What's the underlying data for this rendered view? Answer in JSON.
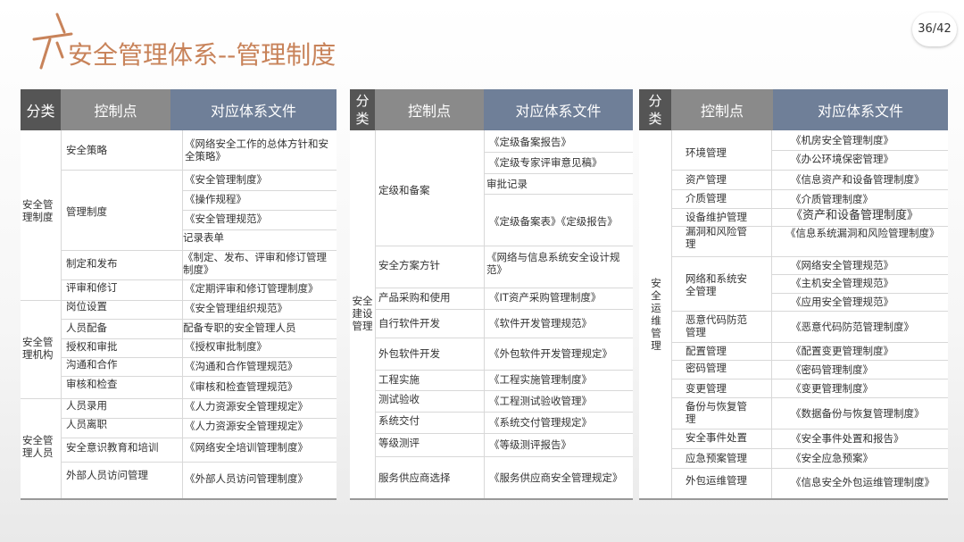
{
  "title": "安全管理体系--管理制度",
  "page": "36/42",
  "panel1": {
    "headers": [
      "分类",
      "控制点",
      "对应体系文件"
    ],
    "categories": [
      "安全管理制度",
      "安全管理机构",
      "安全管理人员"
    ],
    "controls": [
      "安全策略",
      "管理制度",
      "制定和发布",
      "评审和修订",
      "岗位设置",
      "人员配备",
      "授权和审批",
      "沟通和合作",
      "审核和检查",
      "人员录用",
      "人员离职",
      "安全意识教育和培训",
      "外部人员访问管理"
    ],
    "docs": [
      "《网络安全工作的总体方针和安全策略》",
      "《安全管理制度》",
      "《操作规程》",
      "《安全管理规范》",
      "记录表单",
      "《制定、发布、评审和修订管理制度》",
      "《定期评审和修订管理制度》",
      "《安全管理组织规范》",
      "配备专职的安全管理人员",
      "《授权审批制度》",
      "《沟通和合作管理规范》",
      "《审核和检查管理规范》",
      "《人力资源安全管理规定》",
      "《人力资源安全管理规定》",
      "《网络安全培训管理制度》",
      "《外部人员访问管理制度》"
    ]
  },
  "panel2": {
    "headers": [
      "分类",
      "控制点",
      "对应体系文件"
    ],
    "category": "安全建设管理",
    "controls": [
      "定级和备案",
      "安全方案方针",
      "产品采购和使用",
      "自行软件开发",
      "外包软件开发",
      "工程实施",
      "测试验收",
      "系统交付",
      "等级测评",
      "服务供应商选择"
    ],
    "docs": [
      "《定级备案报告》",
      "《定级专家评审意见稿》",
      "审批记录",
      "《定级备案表》《定级报告》",
      "《网络与信息系统安全设计规范》",
      "《IT资产采购管理制度》",
      "《软件开发管理规范》",
      "《外包软件开发管理规定》",
      "《工程实施管理制度》",
      "《工程测试验收管理》",
      "《系统交付管理规定》",
      "《等级测评报告》",
      "《服务供应商安全管理规定》"
    ]
  },
  "panel3": {
    "headers": [
      "分类",
      "控制点",
      "对应体系文件"
    ],
    "category": "安全运维管理",
    "controls": [
      "环境管理",
      "资产管理",
      "介质管理",
      "设备维护管理",
      "漏洞和风险管理",
      "网络和系统安全管理",
      "恶意代码防范管理",
      "配置管理",
      "密码管理",
      "变更管理",
      "备份与恢复管理",
      "安全事件处置",
      "应急预案管理",
      "外包运维管理"
    ],
    "docs": [
      "《机房安全管理制度》",
      "《办公环境保密管理》",
      "《信息资产和设备管理制度》",
      "《介质管理制度》",
      "《资产和设备管理制度》",
      "《信息系统漏洞和风险管理制度》",
      "《网络安全管理规范》",
      "《主机安全管理规范》",
      "《应用安全管理规范》",
      "《恶意代码防范管理制度》",
      "《配置变更管理制度》",
      "《密码管理制度》",
      "《变更管理制度》",
      "《数据备份与恢复管理制度》",
      "《安全事件处置和报告》",
      "《安全应急预案》",
      "《信息安全外包运维管理制度》"
    ]
  }
}
